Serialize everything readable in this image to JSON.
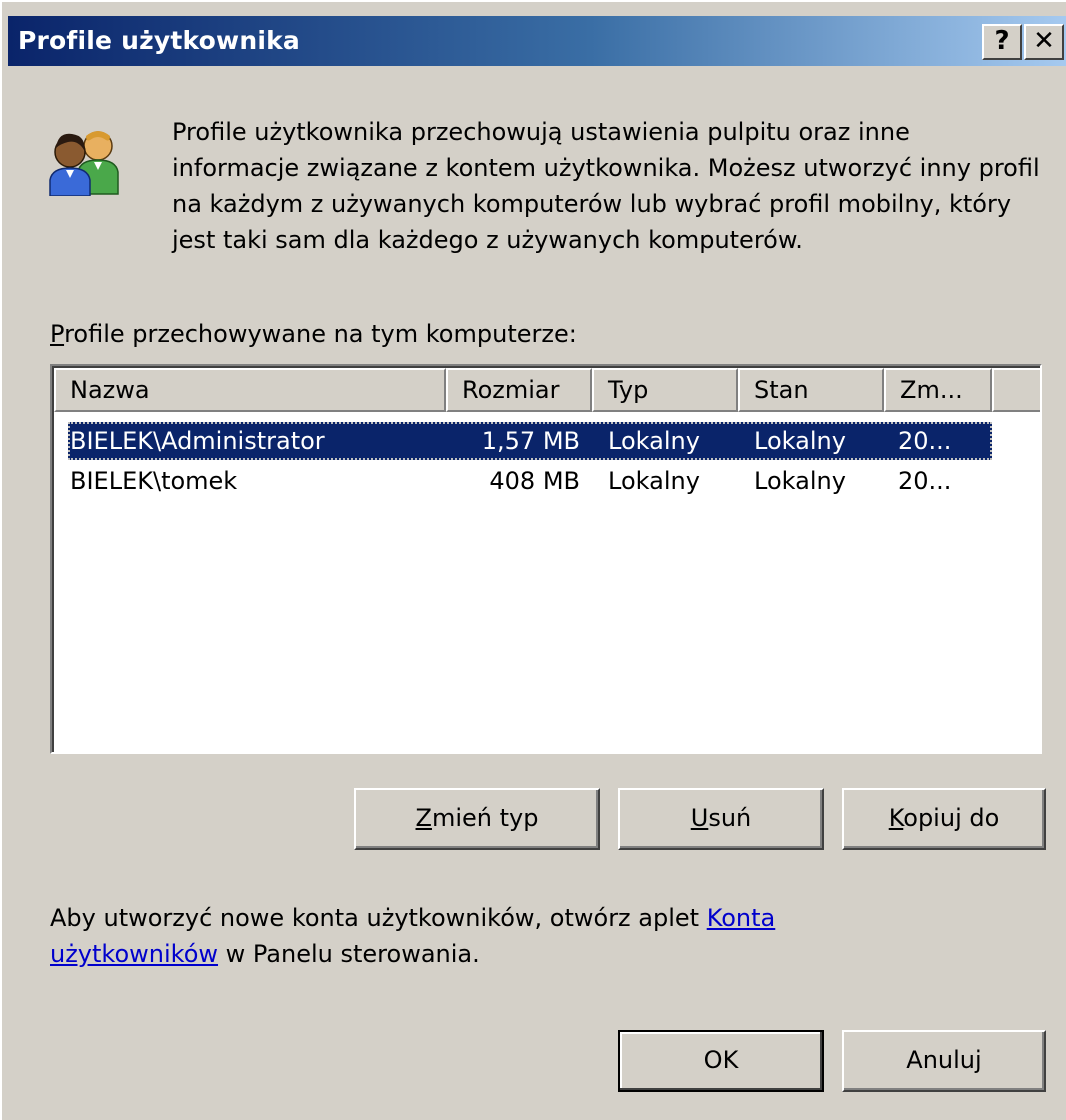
{
  "window": {
    "title": "Profile użytkownika",
    "help_glyph": "?",
    "close_glyph": "✕"
  },
  "description": "Profile użytkownika przechowują ustawienia pulpitu oraz inne informacje związane z kontem użytkownika. Możesz utworzyć inny profil na każdym z używanych komputerów lub wybrać profil mobilny, który jest taki sam dla każdego z używanych komputerów.",
  "profiles_label": {
    "mnemonic": "P",
    "rest": "rofile przechowywane na tym komputerze:"
  },
  "table": {
    "columns": [
      "Nazwa",
      "Rozmiar",
      "Typ",
      "Stan",
      "Zm..."
    ],
    "rows": [
      {
        "name": "BIELEK\\Administrator",
        "size": "1,57 MB",
        "type": "Lokalny",
        "state": "Lokalny",
        "modified": "20...",
        "selected": true
      },
      {
        "name": "BIELEK\\tomek",
        "size": "408 MB",
        "type": "Lokalny",
        "state": "Lokalny",
        "modified": "20...",
        "selected": false
      }
    ]
  },
  "buttons": {
    "change_type": {
      "mnemonic": "Z",
      "rest": "mień typ"
    },
    "delete": {
      "mnemonic": "U",
      "rest": "suń"
    },
    "copy_to": {
      "mnemonic": "K",
      "rest": "opiuj do"
    },
    "ok": "OK",
    "cancel": "Anuluj"
  },
  "info": {
    "text_before": "Aby utworzyć nowe konta użytkowników, otwórz aplet ",
    "link": "Konta użytkowników",
    "text_after": " w Panelu sterowania."
  },
  "icon": "users-icon",
  "colors": {
    "face": "#d4d0c8",
    "title_start": "#0a246a",
    "title_end": "#a6caf0",
    "selection": "#0a246a",
    "link": "#0000cc"
  }
}
